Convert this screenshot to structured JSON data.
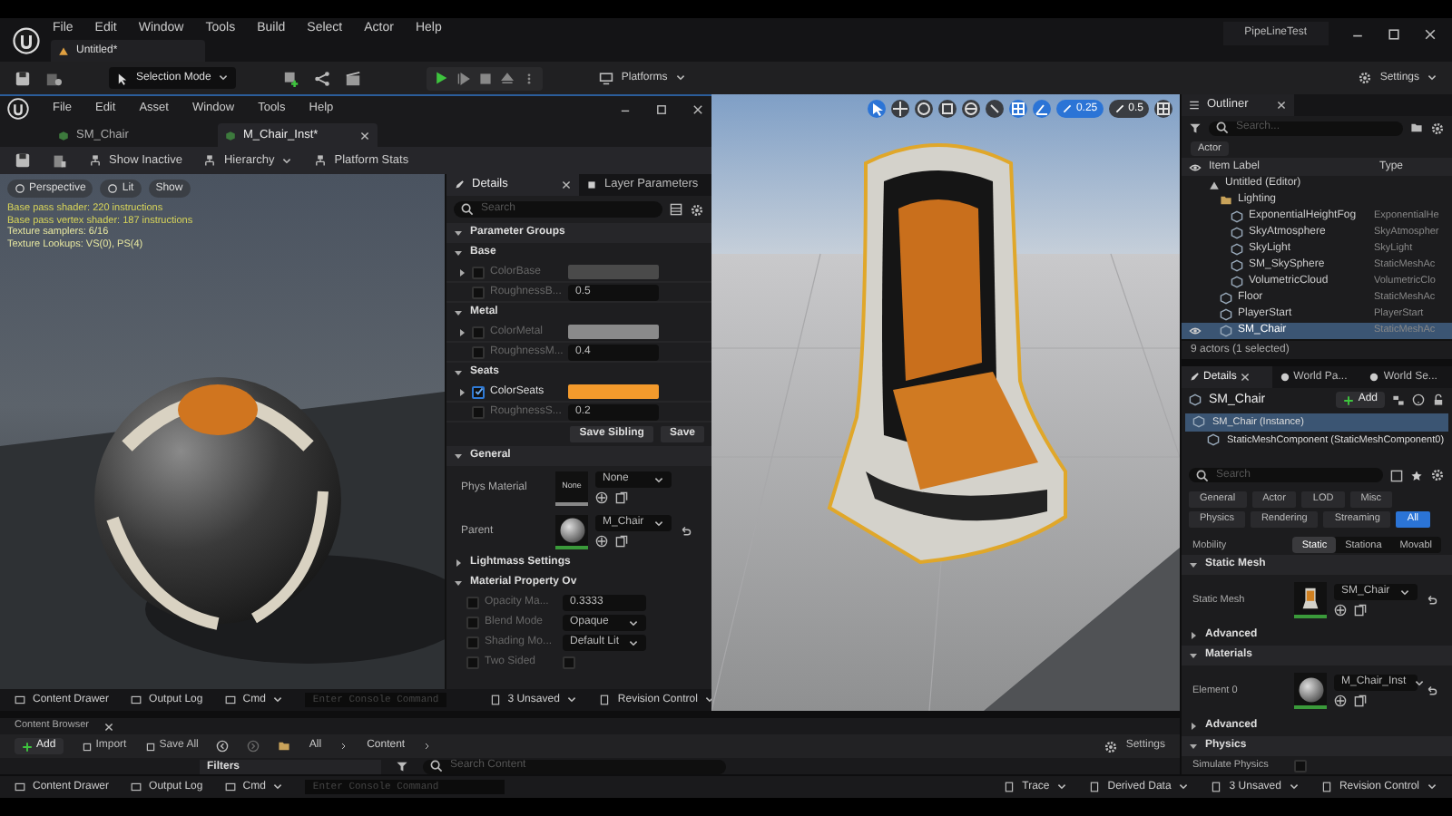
{
  "main_window": {
    "project": "PipeLineTest",
    "menu": [
      "File",
      "Edit",
      "Window",
      "Tools",
      "Build",
      "Select",
      "Actor",
      "Help"
    ],
    "tab": "Untitled*",
    "toolbar": {
      "mode": "Selection Mode",
      "platforms": "Platforms",
      "settings": "Settings"
    }
  },
  "material_editor": {
    "menu": [
      "File",
      "Edit",
      "Asset",
      "Window",
      "Tools",
      "Help"
    ],
    "tabs": [
      {
        "label": "SM_Chair",
        "selected": false
      },
      {
        "label": "M_Chair_Inst*",
        "selected": true
      }
    ],
    "toolbar": [
      "Show Inactive",
      "Hierarchy",
      "Platform Stats"
    ],
    "viewport": {
      "buttons": [
        "Perspective",
        "Lit",
        "Show"
      ],
      "stats": [
        "Base pass shader: 220 instructions",
        "Base pass vertex shader: 187 instructions",
        "Texture samplers: 6/16",
        "Texture Lookups: VS(0), PS(4)"
      ]
    },
    "details": {
      "tabs": [
        {
          "label": "Details",
          "selected": true
        },
        {
          "label": "Layer Parameters",
          "selected": false
        }
      ],
      "search_placeholder": "Search",
      "header": "Parameter Groups",
      "groups": [
        {
          "label": "Base",
          "expanded": true,
          "params": [
            {
              "kind": "color",
              "label": "ColorBase",
              "checked": false,
              "color": "#4a4a4a"
            },
            {
              "kind": "scalar",
              "label": "RoughnessB...",
              "checked": false,
              "value": "0.5"
            }
          ]
        },
        {
          "label": "Metal",
          "expanded": true,
          "params": [
            {
              "kind": "color",
              "label": "ColorMetal",
              "checked": false,
              "color": "#8a8a8a"
            },
            {
              "kind": "scalar",
              "label": "RoughnessM...",
              "checked": false,
              "value": "0.4"
            }
          ]
        },
        {
          "label": "Seats",
          "expanded": true,
          "params": [
            {
              "kind": "color",
              "label": "ColorSeats",
              "checked": true,
              "color": "#f39a2c"
            },
            {
              "kind": "scalar",
              "label": "RoughnessS...",
              "checked": false,
              "value": "0.2"
            }
          ]
        }
      ],
      "save_buttons": [
        "Save Sibling",
        "Save"
      ],
      "general": {
        "title": "General",
        "expanded": true,
        "rows": [
          {
            "label": "Phys Material",
            "thumbnail": "None",
            "value": "None",
            "kind": "empty"
          },
          {
            "label": "Parent",
            "value": "M_Chair",
            "kind": "sphere"
          }
        ]
      },
      "lightmass": {
        "title": "Lightmass Settings",
        "expanded": false
      },
      "overrides": {
        "title": "Material Property Ov",
        "expanded": true,
        "rows": [
          {
            "kind": "number",
            "label": "Opacity Ma...",
            "enabled": false,
            "value": "0.3333"
          },
          {
            "kind": "dropdown",
            "label": "Blend Mode",
            "enabled": false,
            "value": "Opaque"
          },
          {
            "kind": "dropdown",
            "label": "Shading Mo...",
            "enabled": false,
            "value": "Default Lit"
          },
          {
            "kind": "checkbox",
            "label": "Two Sided",
            "enabled": false,
            "checked": false
          }
        ]
      }
    },
    "status_bar": {
      "left": [
        "Content Drawer",
        "Output Log",
        "Cmd"
      ],
      "console_placeholder": "Enter Console Command",
      "right": [
        "3 Unsaved",
        "Revision Control"
      ]
    }
  },
  "level_viewport": {
    "values": [
      "0.25",
      "0.5"
    ]
  },
  "outliner": {
    "title": "Outliner",
    "search_placeholder": "Search...",
    "filter": "Actor",
    "columns": [
      "Item Label",
      "Type"
    ],
    "tree": [
      {
        "label": "Untitled (Editor)",
        "kind": "world",
        "selected": false,
        "children": [
          {
            "label": "Lighting",
            "kind": "folder",
            "selected": false,
            "children": [
              {
                "label": "ExponentialHeightFog",
                "type": "ExponentialHe",
                "kind": "actor",
                "selected": false
              },
              {
                "label": "SkyAtmosphere",
                "type": "SkyAtmospher",
                "kind": "actor",
                "selected": false
              },
              {
                "label": "SkyLight",
                "type": "SkyLight",
                "kind": "actor",
                "selected": false
              },
              {
                "label": "SM_SkySphere",
                "type": "StaticMeshAc",
                "kind": "actor",
                "selected": false
              },
              {
                "label": "VolumetricCloud",
                "type": "VolumetricClo",
                "kind": "actor",
                "selected": false
              }
            ]
          },
          {
            "label": "Floor",
            "type": "StaticMeshAc",
            "kind": "actor",
            "selected": false
          },
          {
            "label": "PlayerStart",
            "type": "PlayerStart",
            "kind": "actor",
            "selected": false
          },
          {
            "label": "SM_Chair",
            "type": "StaticMeshAc",
            "kind": "actor",
            "selected": true
          }
        ]
      }
    ],
    "footer": "9 actors (1 selected)"
  },
  "actor_details": {
    "tabs": [
      {
        "label": "Details",
        "selected": true
      },
      {
        "label": "World Pa...",
        "selected": false
      },
      {
        "label": "World Se...",
        "selected": false
      }
    ],
    "name": "SM_Chair",
    "add": "Add",
    "components": [
      {
        "label": "SM_Chair (Instance)",
        "selected": true
      },
      {
        "label": "StaticMeshComponent (StaticMeshComponent0)",
        "selected": false
      }
    ],
    "search_placeholder": "Search",
    "filters": [
      {
        "label": "General",
        "selected": false
      },
      {
        "label": "Actor",
        "selected": false
      },
      {
        "label": "LOD",
        "selected": false
      },
      {
        "label": "Misc",
        "selected": false
      },
      {
        "label": "Physics",
        "selected": false
      },
      {
        "label": "Rendering",
        "selected": false
      },
      {
        "label": "Streaming",
        "selected": false
      },
      {
        "label": "All",
        "selected": true
      }
    ],
    "mobility": {
      "label": "Mobility",
      "options": [
        {
          "label": "Static",
          "selected": true
        },
        {
          "label": "Stationa",
          "selected": false
        },
        {
          "label": "Movabl",
          "selected": false
        }
      ]
    },
    "sections": [
      {
        "title": "Static Mesh",
        "expanded": true,
        "rows": [
          {
            "kind": "mesh",
            "label": "Static Mesh",
            "value": "SM_Chair"
          },
          {
            "kind": "subsection",
            "label": "Advanced",
            "expanded": false
          }
        ]
      },
      {
        "title": "Materials",
        "expanded": true,
        "rows": [
          {
            "kind": "material",
            "label": "Element 0",
            "value": "M_Chair_Inst"
          },
          {
            "kind": "subsection",
            "label": "Advanced",
            "expanded": false
          }
        ]
      },
      {
        "title": "Physics",
        "expanded": true,
        "rows": [
          {
            "kind": "checkbox",
            "label": "Simulate Physics",
            "checked": false
          }
        ]
      }
    ]
  },
  "content_browser": {
    "tab": "Content Browser",
    "buttons": [
      "Add",
      "Import",
      "Save All"
    ],
    "path": [
      "All",
      "Content"
    ],
    "settings": "Settings",
    "filters": "Filters",
    "search_placeholder": "Search Content"
  },
  "status_bar": {
    "left": [
      "Content Drawer",
      "Output Log",
      "Cmd"
    ],
    "console_placeholder": "Enter Console Command",
    "right": [
      "Trace",
      "Derived Data",
      "3 Unsaved",
      "Revision Control"
    ]
  }
}
